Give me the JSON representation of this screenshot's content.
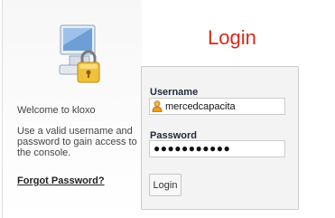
{
  "left": {
    "welcome": "Welcome to kloxo",
    "help_text": "Use a valid username and password to gain access to the console.",
    "forgot_link": "Forgot Password?",
    "icon": "computer-lock-icon"
  },
  "login": {
    "title": "Login",
    "title_color": "#d42a1b",
    "username_label": "Username",
    "username_value": "mercedcapacita",
    "username_icon": "user-icon",
    "password_label": "Password",
    "password_mask": "●●●●●●●●●●●",
    "button_label": "Login"
  }
}
